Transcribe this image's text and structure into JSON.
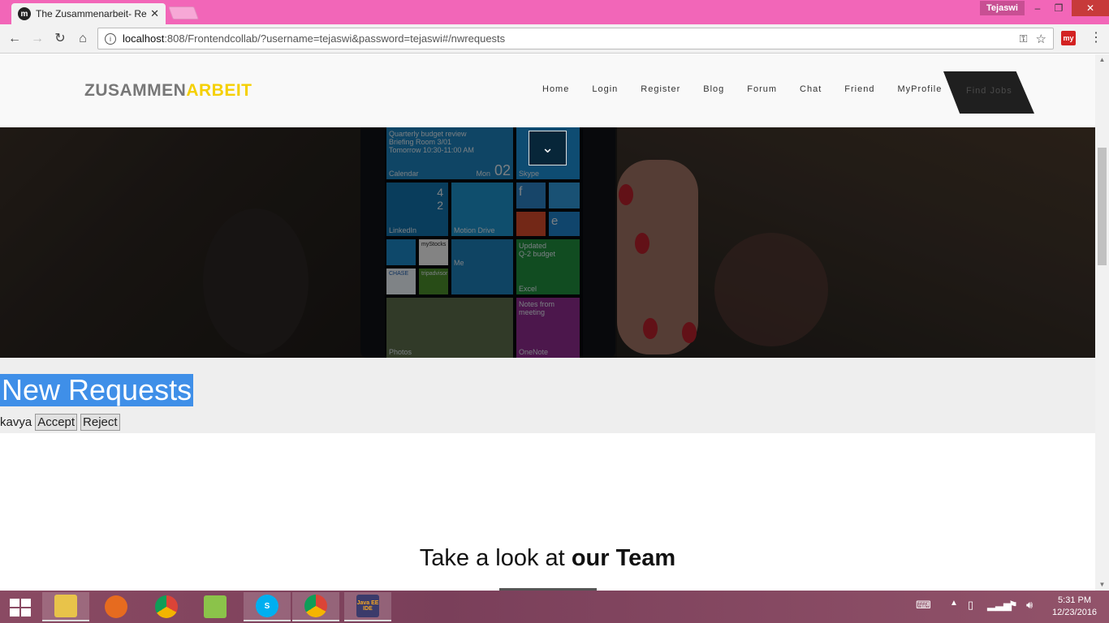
{
  "browser": {
    "tab_title": "The Zusammenarbeit- Re",
    "tab_close": "✕",
    "profile": "Tejaswi",
    "url_host": "localhost",
    "url_rest": ":808/Frontendcollab/?username=tejaswi&password=tejaswi#/nwrequests",
    "extension_label": "my",
    "window_controls": {
      "minimize": "–",
      "maximize": "❐",
      "close": "✕"
    }
  },
  "site": {
    "logo_part1": "ZUSAMMEN",
    "logo_part2": "ARBEIT",
    "nav": [
      "Home",
      "Login",
      "Register",
      "Blog",
      "Forum",
      "Chat",
      "Friend",
      "MyProfile"
    ],
    "find_jobs": "Find Jobs"
  },
  "hero": {
    "down_button": "⌄",
    "tiles": {
      "calendar_lines": [
        "Quarterly budget review",
        "Briefing Room 3/01",
        "Tomorrow 10:30-11:00 AM"
      ],
      "calendar": "Calendar",
      "mon": "Mon",
      "date": "02",
      "skype": "Skype",
      "linkedin": "LinkedIn",
      "counts": [
        "4",
        "2"
      ],
      "motion_drive": "Motion Drive",
      "updated": "Updated",
      "budget": "Q-2 budget",
      "excel": "Excel",
      "me": "Me",
      "mystocks": "myStocks",
      "chase": "CHASE",
      "advisor": "tripadvisor",
      "notes1": "Notes from",
      "notes2": "meeting",
      "onenote": "OneNote",
      "photos": "Photos"
    }
  },
  "requests": {
    "title": "New Requests",
    "items": [
      {
        "name": "kavya",
        "accept": "Accept",
        "reject": "Reject"
      }
    ]
  },
  "team": {
    "prefix": "Take a look at",
    "bold": "our Team"
  },
  "taskbar": {
    "apps": [
      "explorer-icon",
      "firefox-icon",
      "chrome-icon",
      "notepad-icon",
      "skype-icon",
      "chrome-icon",
      "java-ee-ide-icon"
    ],
    "java_label": "Java EE IDE",
    "time": "5:31 PM",
    "date": "12/23/2016"
  },
  "colors": {
    "title_bar": "#f266b8",
    "logo_accent": "#f5d000",
    "selection": "#3f8fe8"
  }
}
